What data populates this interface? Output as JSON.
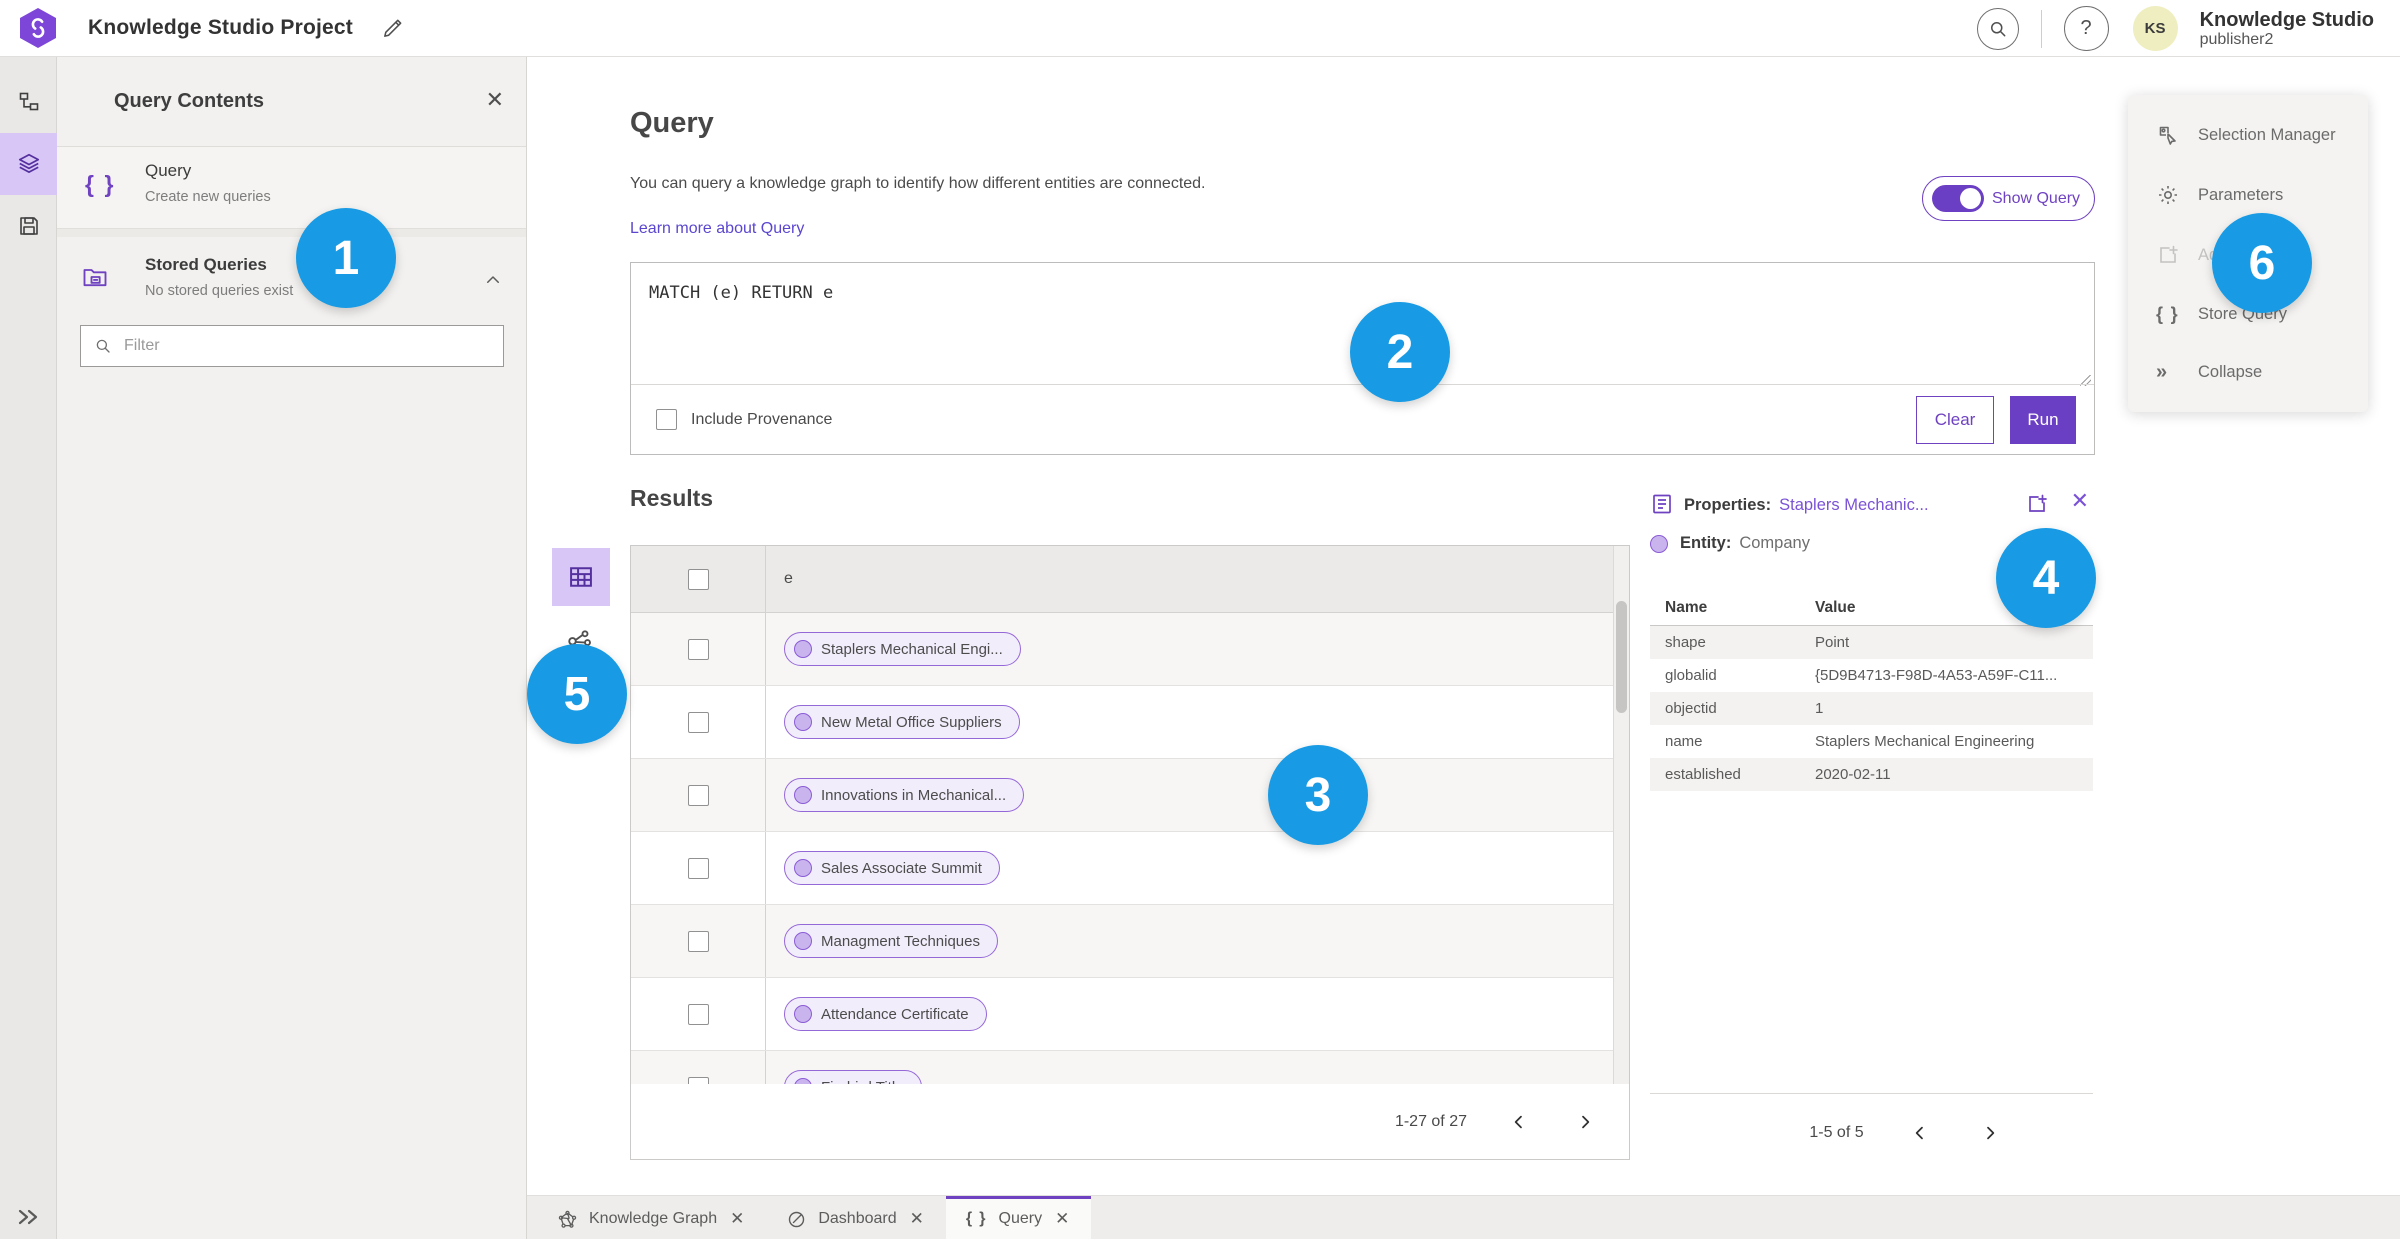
{
  "colors": {
    "accent_purple": "#6f42c1",
    "run_button": "#6b3fc3",
    "badge_blue": "#189be4",
    "pill_fill": "#f2edfb",
    "pill_border": "#9568d8",
    "link_purple": "#5a46cf",
    "avatar_bg": "#efeec0",
    "rail_selected_bg": "#d8c6f6"
  },
  "topbar": {
    "title": "Knowledge Studio Project",
    "user": {
      "initials": "KS",
      "display_name": "Knowledge Studio",
      "username": "publisher2"
    }
  },
  "left_rail": {
    "icons": [
      "hierarchy-icon",
      "layers-icon",
      "save-icon",
      "expand-icon"
    ]
  },
  "query_contents": {
    "title": "Query Contents",
    "query_item": {
      "title": "Query",
      "subtitle": "Create new queries"
    },
    "stored_item": {
      "title": "Stored Queries",
      "subtitle": "No stored queries exist"
    },
    "filter_placeholder": "Filter"
  },
  "query_panel": {
    "title": "Query",
    "description": "You can query a knowledge graph to identify how different entities are connected.",
    "learn_more_label": "Learn more about Query",
    "show_query_label": "Show Query",
    "query_text": "MATCH (e) RETURN e",
    "include_provenance_label": "Include Provenance",
    "clear_label": "Clear",
    "run_label": "Run"
  },
  "results": {
    "title": "Results",
    "column_header": "e",
    "rows": [
      "Staplers Mechanical Engi...",
      "New Metal Office Suppliers",
      "Innovations in Mechanical...",
      "Sales Associate Summit",
      "Managment Techniques",
      "Attendance Certificate",
      "Firebird Title"
    ],
    "pagination": "1-27 of 27"
  },
  "properties_panel": {
    "header_label": "Properties:",
    "header_entity": "Staplers Mechanic...",
    "entity_label": "Entity:",
    "entity_type": "Company",
    "col_name": "Name",
    "col_value": "Value",
    "rows": [
      {
        "name": "shape",
        "value": "Point"
      },
      {
        "name": "globalid",
        "value": "{5D9B4713-F98D-4A53-A59F-C11..."
      },
      {
        "name": "objectid",
        "value": "1"
      },
      {
        "name": "name",
        "value": "Staplers Mechanical Engineering"
      },
      {
        "name": "established",
        "value": "2020-02-11"
      }
    ],
    "pagination": "1-5 of 5"
  },
  "side_menu": {
    "items": [
      {
        "label": "Selection Manager",
        "icon": "selection-manager-icon"
      },
      {
        "label": "Parameters",
        "icon": "gear-icon"
      },
      {
        "label": "Ad",
        "icon": "add-to-new-icon",
        "disabled": true
      },
      {
        "label": "Store Query",
        "icon": "braces-icon"
      },
      {
        "label": "Collapse",
        "icon": "collapse-icon"
      }
    ]
  },
  "bottom_tabs": [
    {
      "label": "Knowledge Graph",
      "icon": "knowledge-graph-icon"
    },
    {
      "label": "Dashboard",
      "icon": "dashboard-icon"
    },
    {
      "label": "Query",
      "icon": "braces-icon",
      "active": true
    }
  ],
  "annotations": [
    "1",
    "2",
    "3",
    "4",
    "5",
    "6"
  ]
}
